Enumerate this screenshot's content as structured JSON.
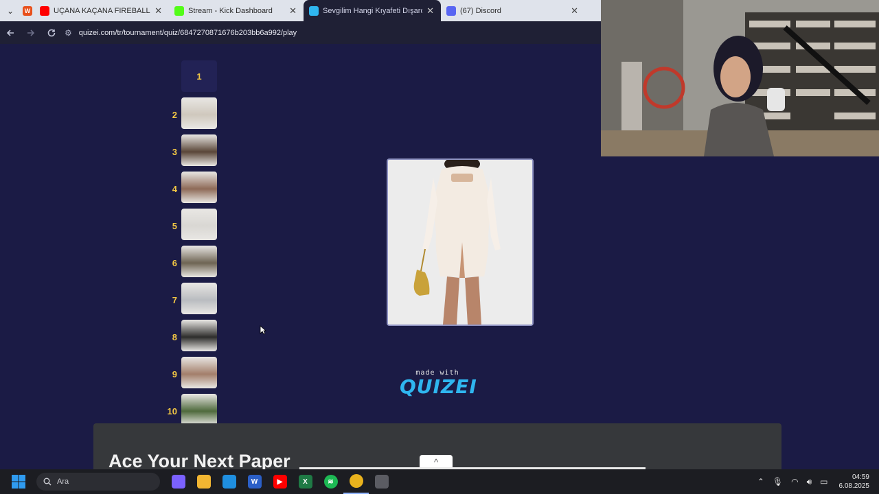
{
  "browser": {
    "tabs": [
      {
        "title": "UÇANA KAÇANA FIREBALLI | M",
        "favicon": "youtube-icon",
        "color": "#ff0000"
      },
      {
        "title": "Stream - Kick Dashboard",
        "favicon": "kick-icon",
        "color": "#53fc18"
      },
      {
        "title": "Sevgilim Hangi Kıyafeti Dışarda",
        "favicon": "quizei-icon",
        "color": "#2fb6ef",
        "active": true
      },
      {
        "title": "(67) Discord",
        "favicon": "discord-icon",
        "color": "#5865f2"
      }
    ],
    "url": "quizei.com/tr/tournament/quiz/6847270871676b203bb6a992/play"
  },
  "page": {
    "ranks": [
      {
        "num": "1",
        "empty": true
      },
      {
        "num": "2",
        "swatch": "#cfc8bd"
      },
      {
        "num": "3",
        "swatch": "#5a4638"
      },
      {
        "num": "4",
        "swatch": "#8e6a57"
      },
      {
        "num": "5",
        "swatch": "#d9d7d3"
      },
      {
        "num": "6",
        "swatch": "#6e6453"
      },
      {
        "num": "7",
        "swatch": "#b9bcc0"
      },
      {
        "num": "8",
        "swatch": "#2d2d2b"
      },
      {
        "num": "9",
        "swatch": "#a37f6b"
      },
      {
        "num": "10",
        "swatch": "#4f6a3c"
      }
    ],
    "brand": {
      "made_with": "made with",
      "logo": "QUIZEI"
    }
  },
  "ad": {
    "title": "Ace Your Next Paper",
    "toggle": "^"
  },
  "taskbar": {
    "search_label": "Ara",
    "apps": [
      {
        "name": "copilot-icon",
        "color": "#7b61ff",
        "label": ""
      },
      {
        "name": "file-explorer-icon",
        "color": "#f2b632",
        "label": ""
      },
      {
        "name": "edge-icon",
        "color": "#1f8fe0",
        "label": ""
      },
      {
        "name": "word-icon",
        "color": "#2b5fc7",
        "label": "W"
      },
      {
        "name": "youtube-icon",
        "color": "#ff0000",
        "label": "▶"
      },
      {
        "name": "excel-icon",
        "color": "#1f7a45",
        "label": "X"
      },
      {
        "name": "spotify-icon",
        "color": "#1db954",
        "label": "≋"
      },
      {
        "name": "chrome-icon",
        "color": "#e9b21d",
        "label": "",
        "active": true
      },
      {
        "name": "settings-icon",
        "color": "#5b5c63",
        "label": ""
      }
    ],
    "time": "04:59",
    "date": "6.08.2025"
  }
}
